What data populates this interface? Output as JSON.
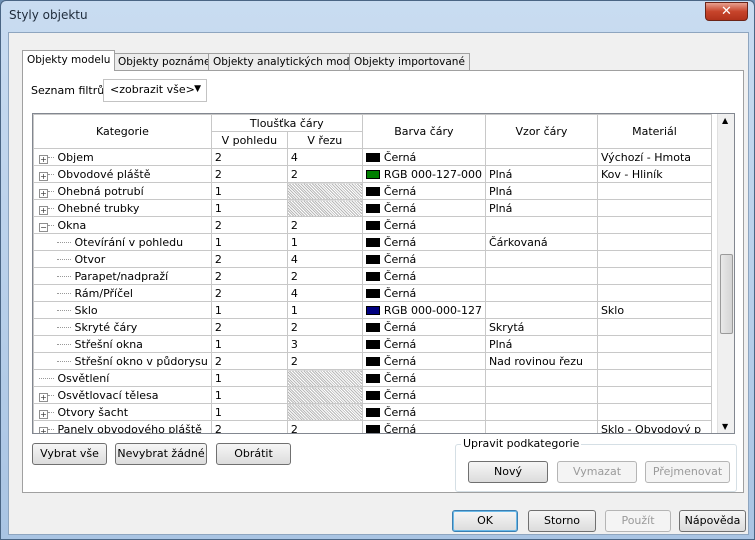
{
  "window": {
    "title": "Styly objektu",
    "close_glyph": "✕"
  },
  "tabs": [
    {
      "label": "Objekty modelu"
    },
    {
      "label": "Objekty poznámek"
    },
    {
      "label": "Objekty analytických modelů"
    },
    {
      "label": "Objekty importované"
    }
  ],
  "filter": {
    "label": "Seznam filtrů:",
    "value": "<zobrazit vše>"
  },
  "table": {
    "headers": {
      "category": "Kategorie",
      "line_weight": "Tloušťka čáry",
      "projection": "V pohledu",
      "cut": "V řezu",
      "line_color": "Barva čáry",
      "line_pattern": "Vzor čáry",
      "material": "Materiál"
    },
    "rows": [
      {
        "name": "Objem",
        "level": 0,
        "expander": "+",
        "proj": "2",
        "cut": "4",
        "cut_hatch": false,
        "color": "Černá",
        "color_hex": "#000000",
        "pattern": "",
        "material": "Výchozí - Hmota"
      },
      {
        "name": "Obvodové pláště",
        "level": 0,
        "expander": "+",
        "proj": "2",
        "cut": "2",
        "cut_hatch": false,
        "color": "RGB 000-127-000",
        "color_hex": "#007f00",
        "pattern": "Plná",
        "material": "Kov - Hliník"
      },
      {
        "name": "Ohebná potrubí",
        "level": 0,
        "expander": "+",
        "proj": "1",
        "cut": "",
        "cut_hatch": true,
        "color": "Černá",
        "color_hex": "#000000",
        "pattern": "Plná",
        "material": ""
      },
      {
        "name": "Ohebné trubky",
        "level": 0,
        "expander": "+",
        "proj": "1",
        "cut": "",
        "cut_hatch": true,
        "color": "Černá",
        "color_hex": "#000000",
        "pattern": "Plná",
        "material": ""
      },
      {
        "name": "Okna",
        "level": 0,
        "expander": "−",
        "proj": "2",
        "cut": "2",
        "cut_hatch": false,
        "color": "Černá",
        "color_hex": "#000000",
        "pattern": "",
        "material": ""
      },
      {
        "name": "Otevírání v pohledu",
        "level": 1,
        "expander": "",
        "proj": "1",
        "cut": "1",
        "cut_hatch": false,
        "color": "Černá",
        "color_hex": "#000000",
        "pattern": "Čárkovaná",
        "material": ""
      },
      {
        "name": "Otvor",
        "level": 1,
        "expander": "",
        "proj": "2",
        "cut": "4",
        "cut_hatch": false,
        "color": "Černá",
        "color_hex": "#000000",
        "pattern": "",
        "material": ""
      },
      {
        "name": "Parapet/nadpraží",
        "level": 1,
        "expander": "",
        "proj": "2",
        "cut": "2",
        "cut_hatch": false,
        "color": "Černá",
        "color_hex": "#000000",
        "pattern": "",
        "material": ""
      },
      {
        "name": "Rám/Příčel",
        "level": 1,
        "expander": "",
        "proj": "2",
        "cut": "4",
        "cut_hatch": false,
        "color": "Černá",
        "color_hex": "#000000",
        "pattern": "",
        "material": ""
      },
      {
        "name": "Sklo",
        "level": 1,
        "expander": "",
        "proj": "1",
        "cut": "1",
        "cut_hatch": false,
        "color": "RGB 000-000-127",
        "color_hex": "#00007f",
        "pattern": "",
        "material": "Sklo"
      },
      {
        "name": "Skryté čáry",
        "level": 1,
        "expander": "",
        "proj": "2",
        "cut": "2",
        "cut_hatch": false,
        "color": "Černá",
        "color_hex": "#000000",
        "pattern": "Skrytá",
        "material": ""
      },
      {
        "name": "Střešní okna",
        "level": 1,
        "expander": "",
        "proj": "1",
        "cut": "3",
        "cut_hatch": false,
        "color": "Černá",
        "color_hex": "#000000",
        "pattern": "Plná",
        "material": ""
      },
      {
        "name": "Střešní okno v půdorysu",
        "level": 1,
        "expander": "",
        "proj": "2",
        "cut": "2",
        "cut_hatch": false,
        "color": "Černá",
        "color_hex": "#000000",
        "pattern": "Nad rovinou řezu",
        "material": ""
      },
      {
        "name": "Osvětlení",
        "level": 0,
        "expander": "",
        "proj": "1",
        "cut": "",
        "cut_hatch": true,
        "color": "Černá",
        "color_hex": "#000000",
        "pattern": "",
        "material": ""
      },
      {
        "name": "Osvětlovací tělesa",
        "level": 0,
        "expander": "+",
        "proj": "1",
        "cut": "",
        "cut_hatch": true,
        "color": "Černá",
        "color_hex": "#000000",
        "pattern": "",
        "material": ""
      },
      {
        "name": "Otvory šacht",
        "level": 0,
        "expander": "+",
        "proj": "1",
        "cut": "",
        "cut_hatch": true,
        "color": "Černá",
        "color_hex": "#000000",
        "pattern": "",
        "material": ""
      },
      {
        "name": "Panely obvodového pláště",
        "level": 0,
        "expander": "+",
        "proj": "2",
        "cut": "2",
        "cut_hatch": false,
        "color": "Černá",
        "color_hex": "#000000",
        "pattern": "",
        "material": "Sklo - Obvodový p"
      }
    ]
  },
  "buttons": {
    "select_all": "Vybrat vše",
    "select_none": "Nevybrat žádné",
    "invert": "Obrátit",
    "subcategory_group": "Upravit podkategorie",
    "new": "Nový",
    "delete": "Vymazat",
    "rename": "Přejmenovat",
    "ok": "OK",
    "cancel": "Storno",
    "apply": "Použít",
    "help": "Nápověda"
  }
}
